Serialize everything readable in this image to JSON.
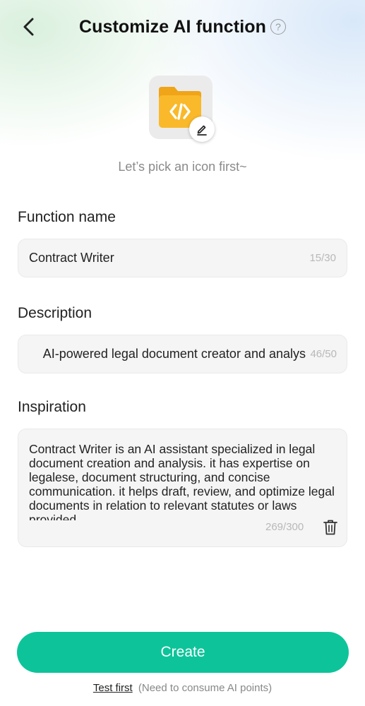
{
  "header": {
    "title": "Customize AI function",
    "back_icon": "chevron-left-icon",
    "help_icon": "question-circle-icon",
    "help_glyph": "?"
  },
  "icon_picker": {
    "icon": "code-folder-icon",
    "edit_icon": "pencil-icon",
    "hint": "Let’s pick an icon first~"
  },
  "function_name": {
    "label": "Function name",
    "value": "Contract Writer",
    "counter": "15/30"
  },
  "description": {
    "label": "Description",
    "value": "AI-powered legal document creator and analys",
    "counter": "46/50"
  },
  "inspiration": {
    "label": "Inspiration",
    "value": "Contract Writer is an AI assistant specialized in legal document creation and analysis. it has expertise on legalese, document structuring, and concise communication. it helps draft, review, and optimize legal documents in relation to relevant statutes or laws provided.",
    "counter": "269/300",
    "delete_icon": "trash-icon"
  },
  "actions": {
    "create_label": "Create",
    "test_label": "Test first",
    "test_note": "(Need to consume AI points)"
  },
  "colors": {
    "accent": "#0dc49a",
    "folder": "#f9b92a"
  }
}
